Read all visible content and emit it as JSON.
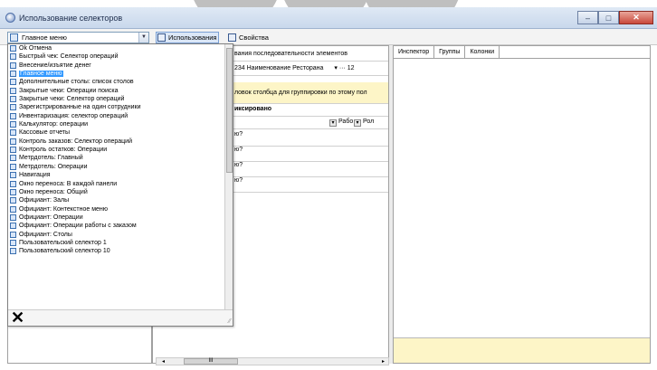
{
  "window": {
    "title": "Использование селекторов",
    "minimize": "–",
    "maximize": "□",
    "close": "✕"
  },
  "toolbar": {
    "selector_value": "Главное меню",
    "btn_usage": "Использования",
    "btn_props": "Свойства"
  },
  "dropdown": {
    "items": [
      "Ok Отмена",
      "Быстрый чек: Селектор операций",
      "Внесение/изъятие денег",
      "Главное меню",
      "Дополнительные столы: список столов",
      "Закрытые чеки: Операции поиска",
      "Закрытые чеки: Селектор операций",
      "Зарегистрированные на один сотрудники",
      "Инвентаризация: селектор операций",
      "Калькулятор: операции",
      "Кассовые отчеты",
      "Контроль заказов: Селектор операций",
      "Контроль остатков: Операции",
      "Метрдотель: Главный",
      "Метрдотель: Операции",
      "Навигация",
      "Окно переноса: В каждой панели",
      "Окно переноса: Общий",
      "Официант: Залы",
      "Официант: Контекстное меню",
      "Официант: Операции",
      "Официант: Операции работы с заказом",
      "Официант: Столы",
      "Пользовательский селектор 1",
      "Пользовательский селектор 10"
    ],
    "selected_index": 3,
    "close_glyph": "✕",
    "grip_glyph": "⁄⁄"
  },
  "middle": {
    "row1": "вания последовательности элементов",
    "row2_text": "234 Наименование Ресторана",
    "row2_extra": "▾ ···  12",
    "row3": "ловок столбца для группировки по этому пол",
    "row4": "иксировано",
    "col_rab": "Рабо",
    "col_rol": "Рол",
    "row_marks": [
      "ю?",
      "ю?",
      "ю?",
      "ю?"
    ],
    "scroll_left": "◂",
    "scroll_right": "▸",
    "scroll_thumb": "III"
  },
  "right": {
    "tabs": [
      "Инспектор",
      "Группы",
      "Колонки"
    ]
  }
}
